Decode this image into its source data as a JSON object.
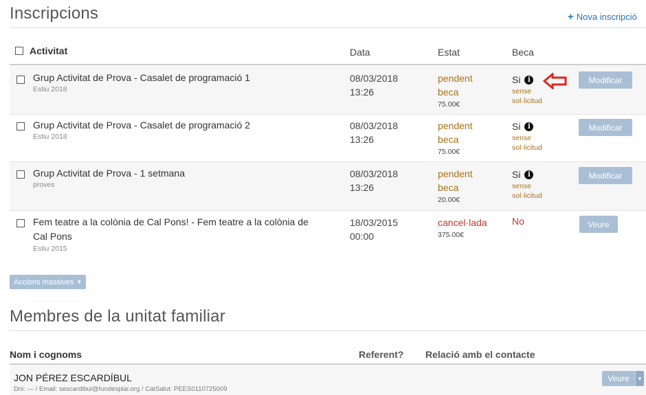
{
  "inscripcions": {
    "title": "Inscripcions",
    "new_link": "Nova inscripció",
    "headers": {
      "activity": "Activitat",
      "date": "Data",
      "state": "Estat",
      "beca": "Beca"
    },
    "rows": [
      {
        "activity": "Grup Activitat de Prova - Casalet de programació 1",
        "sub": "Estiu 2018",
        "date1": "08/03/2018",
        "date2": "13:26",
        "state1": "pendent",
        "state2": "beca",
        "price": "75.00€",
        "beca": "Si",
        "beca_note1": "sense",
        "beca_note2": "sol·licitud",
        "button": "Modificar"
      },
      {
        "activity": "Grup Activitat de Prova - Casalet de programació 2",
        "sub": "Estiu 2018",
        "date1": "08/03/2018",
        "date2": "13:26",
        "state1": "pendent",
        "state2": "beca",
        "price": "75.00€",
        "beca": "Si",
        "beca_note1": "sense",
        "beca_note2": "sol·licitud",
        "button": "Modificar"
      },
      {
        "activity": "Grup Activitat de Prova - 1 setmana",
        "sub": "proves",
        "date1": "08/03/2018",
        "date2": "13:26",
        "state1": "pendent",
        "state2": "beca",
        "price": "20.00€",
        "beca": "Si",
        "beca_note1": "sense",
        "beca_note2": "sol·licitud",
        "button": "Modificar"
      },
      {
        "activity_line1": "Fem teatre a la colònia de Cal Pons! - Fem teatre a la colònia de",
        "activity_line2": "Cal Pons",
        "sub": "Estiu 2015",
        "date1": "18/03/2015",
        "date2": "00:00",
        "state1": "cancel·lada",
        "price": "375.00€",
        "beca": "No",
        "button": "Veure"
      }
    ],
    "mass_actions": "Accions massives"
  },
  "membres": {
    "title": "Membres de la unitat familiar",
    "headers": {
      "name": "Nom i cognoms",
      "referent": "Referent?",
      "relation": "Relació amb el contacte"
    },
    "rows": [
      {
        "name": "JON PÉREZ ESCARDÍBUL",
        "details": "Dni: — / Email: sescardibul@fundesplai.org / CatSalut: PEES0110725009",
        "button": "Veure"
      }
    ]
  },
  "colors": {
    "accent": "#2a72b5",
    "button": "#a9bfd6",
    "pending": "#a6731a",
    "cancelled": "#c0392b",
    "arrow": "#e0261b"
  }
}
